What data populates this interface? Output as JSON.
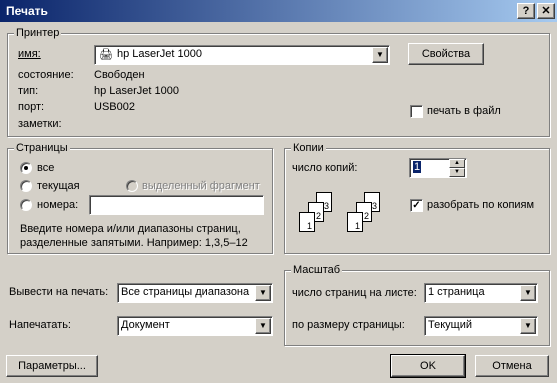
{
  "window": {
    "title": "Печать",
    "help_btn": "?",
    "close_btn": "✕"
  },
  "printer": {
    "group_label": "Принтер",
    "name_label": "имя:",
    "name_value": "hp LaserJet 1000",
    "properties_btn": "Свойства",
    "status_label": "состояние:",
    "status_value": "Свободен",
    "type_label": "тип:",
    "type_value": "hp LaserJet 1000",
    "port_label": "порт:",
    "port_value": "USB002",
    "notes_label": "заметки:",
    "print_to_file": "печать в файл"
  },
  "pages": {
    "group_label": "Страницы",
    "all": "все",
    "current": "текущая",
    "selection": "выделенный фрагмент",
    "numbers": "номера:",
    "numbers_value": "",
    "hint": "Введите номера и/или диапазоны страниц, разделенные запятыми. Например: 1,3,5–12"
  },
  "copies": {
    "group_label": "Копии",
    "count_label": "число копий:",
    "count_value": "1",
    "collate": "разобрать по копиям"
  },
  "output": {
    "print_what_label": "Вывести на печать:",
    "print_what_value": "Все страницы диапазона",
    "print_label": "Напечатать:",
    "print_value": "Документ"
  },
  "zoom": {
    "group_label": "Масштаб",
    "pages_per_sheet_label": "число страниц на листе:",
    "pages_per_sheet_value": "1 страница",
    "scale_label": "по размеру страницы:",
    "scale_value": "Текущий"
  },
  "buttons": {
    "options": "Параметры...",
    "ok": "OK",
    "cancel": "Отмена"
  }
}
